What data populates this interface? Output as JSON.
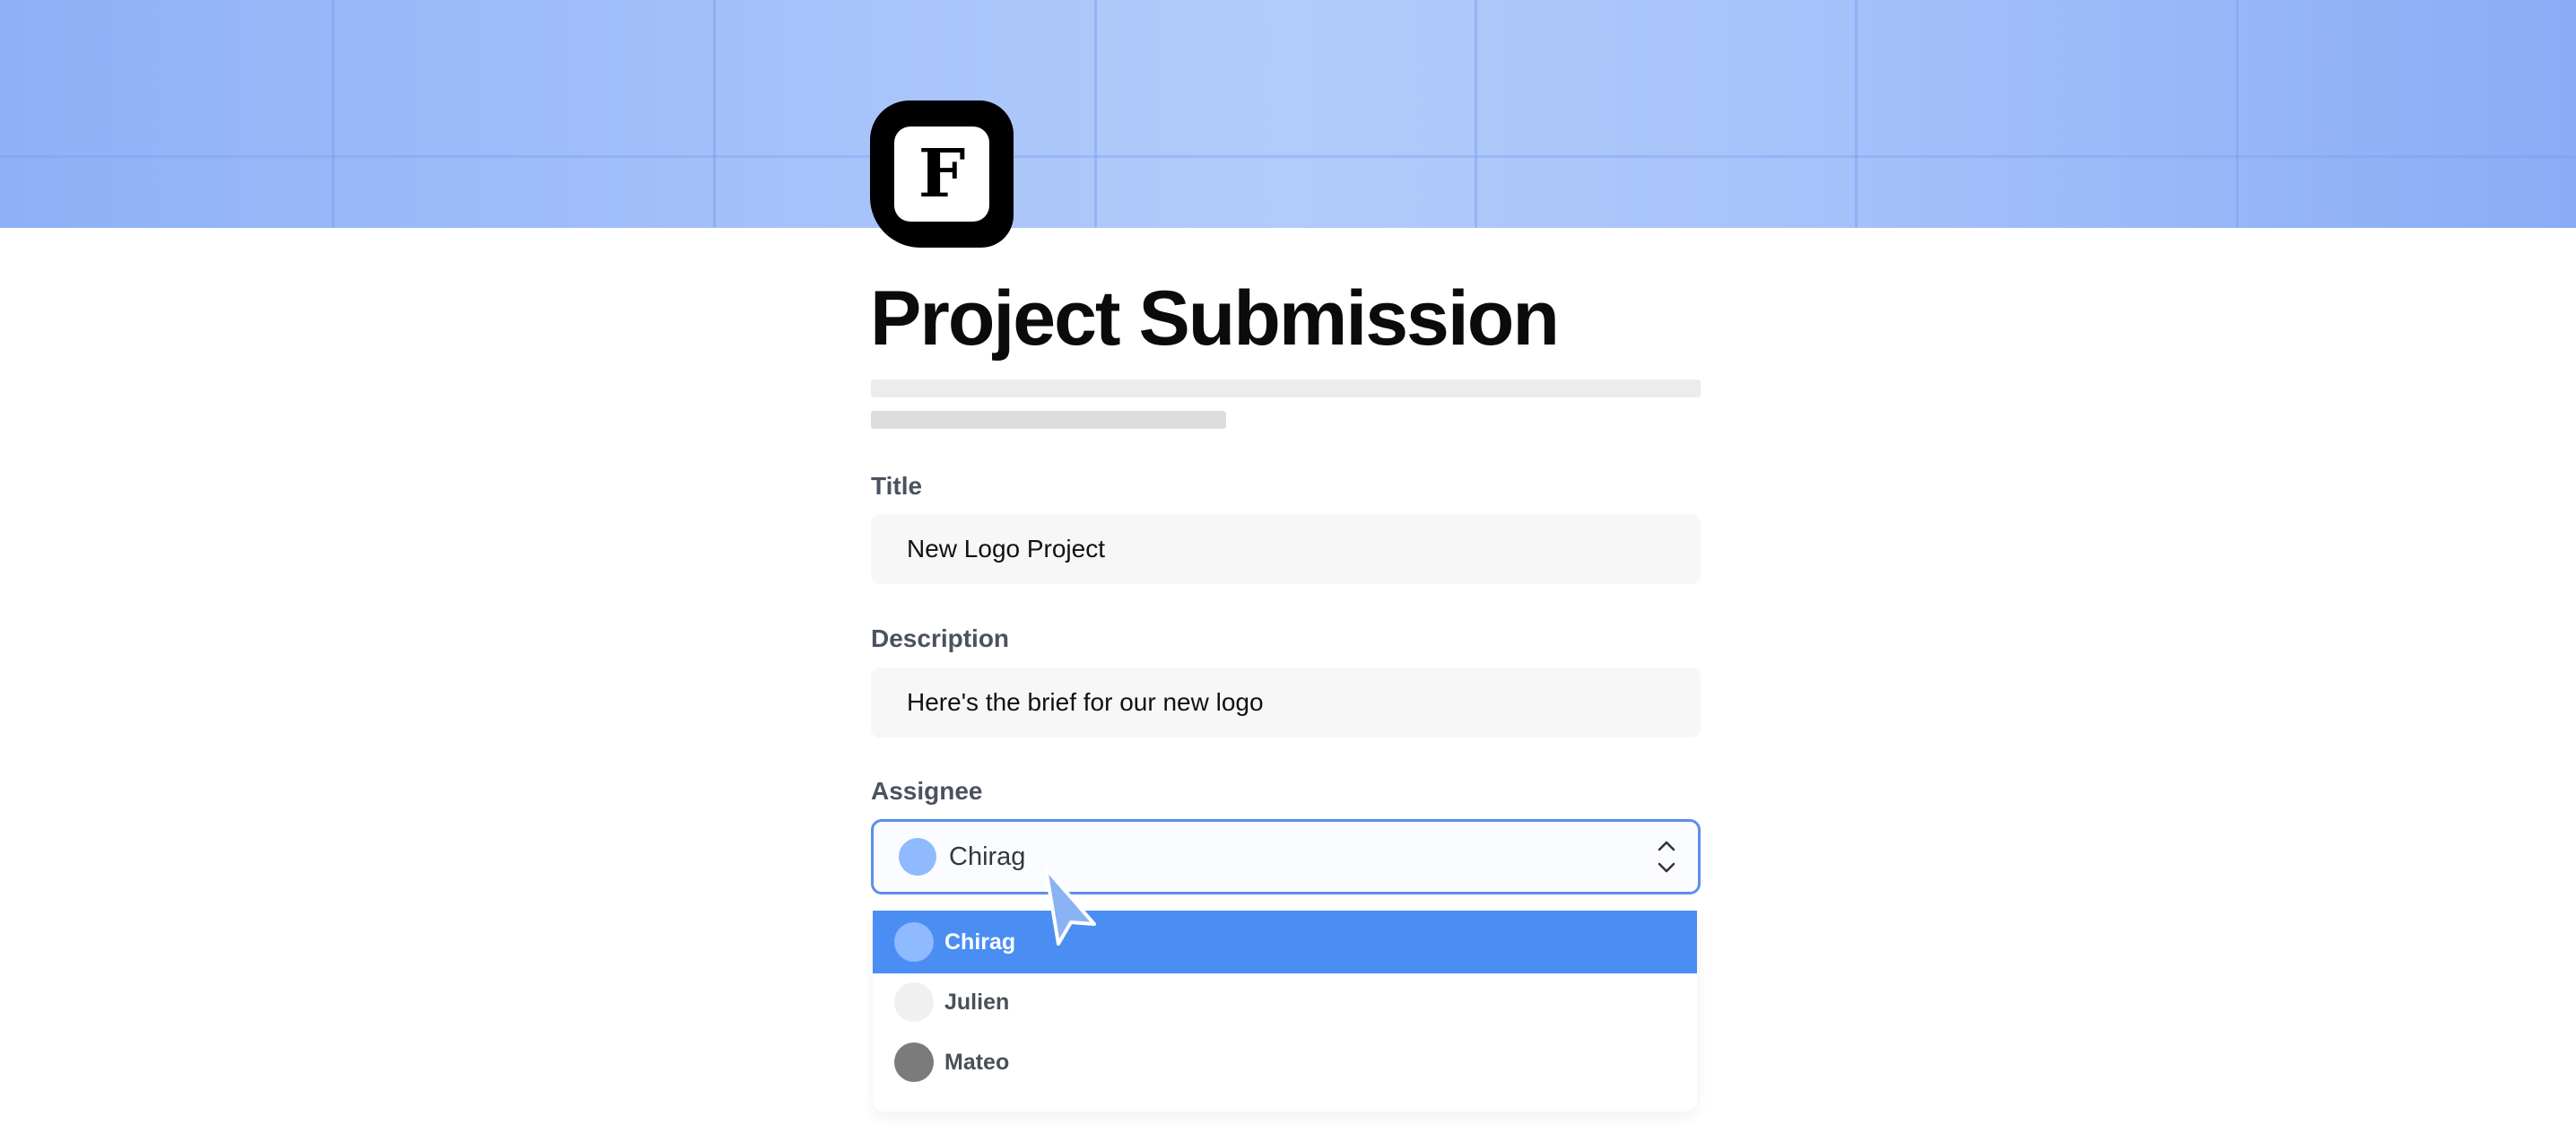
{
  "form": {
    "logo_letter": "F",
    "title": "Project Submission",
    "fields": {
      "title": {
        "label": "Title",
        "value": "New Logo Project"
      },
      "description": {
        "label": "Description",
        "value": "Here's the brief for our new logo"
      },
      "assignee": {
        "label": "Assignee",
        "selected": "Chirag",
        "options": [
          {
            "name": "Chirag",
            "avatar_color": "#8fbaff",
            "selected": true
          },
          {
            "name": "Julien",
            "avatar_color": "#f0f0f1",
            "selected": false
          },
          {
            "name": "Mateo",
            "avatar_color": "#7b7b7b",
            "selected": false
          }
        ]
      }
    }
  },
  "colors": {
    "banner": "#a9c4fa",
    "accent": "#4a8ef4",
    "focus_border": "#5b8fea"
  },
  "icons": [
    "logo-icon",
    "chevron-up-down-icon",
    "cursor-icon"
  ]
}
